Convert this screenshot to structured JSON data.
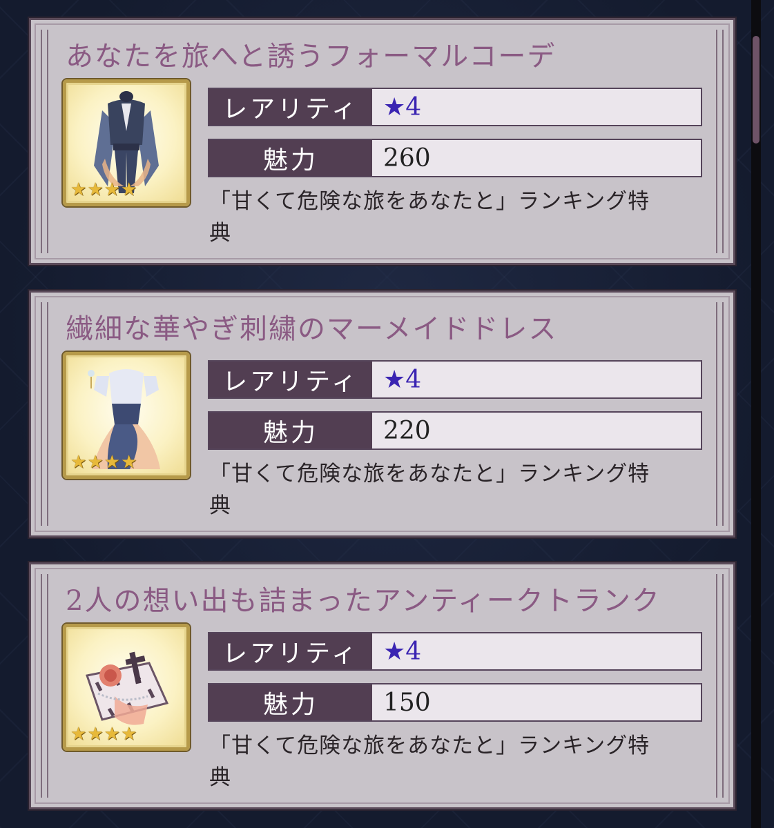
{
  "labels": {
    "rarity": "レアリティ",
    "charm": "魅力"
  },
  "colors": {
    "title": "#8a5a83",
    "rarity_value": "#3a24b2",
    "label_bg": "#523e52",
    "card_bg": "#c8c3c9"
  },
  "items": [
    {
      "name": "あなたを旅へと誘うフォーマルコーデ",
      "rarity": "★4",
      "charm": "260",
      "desc": "「甘くて危険な旅をあなたと」ランキング特典",
      "stars": 4,
      "icon": "formal-suit-icon"
    },
    {
      "name": "繊細な華やぎ刺繍のマーメイドドレス",
      "rarity": "★4",
      "charm": "220",
      "desc": "「甘くて危険な旅をあなたと」ランキング特典",
      "stars": 4,
      "icon": "mermaid-dress-icon"
    },
    {
      "name": "2人の想い出も詰まったアンティークトランク",
      "rarity": "★4",
      "charm": "150",
      "desc": "「甘くて危険な旅をあなたと」ランキング特典",
      "stars": 4,
      "icon": "antique-trunk-icon"
    }
  ]
}
